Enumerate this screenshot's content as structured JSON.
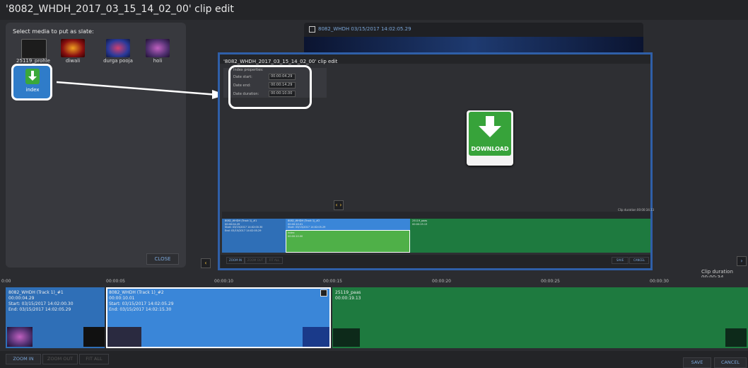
{
  "window": {
    "title": "'8082_WHDH_2017_03_15_14_02_00' clip edit"
  },
  "media_panel": {
    "label": "Select media to put as slate:",
    "items": [
      {
        "label": "25119_prohle",
        "icon": "video-thumbnail-icon"
      },
      {
        "label": "diwali",
        "icon": "diwali-thumbnail-icon"
      },
      {
        "label": "durga pooja",
        "icon": "durga-pooja-thumbnail-icon"
      },
      {
        "label": "holi",
        "icon": "holi-thumbnail-icon"
      },
      {
        "label": "index",
        "icon": "download-icon"
      }
    ],
    "close_label": "CLOSE"
  },
  "preview": {
    "title": "8082_WHDH  03/15/2017 14:02:05.29"
  },
  "nested": {
    "title": "'8082_WHDH_2017_03_15_14_02_00' clip edit",
    "props_heading": "Index properties:",
    "date_start_label": "Date start:",
    "date_start": "00:00:04.29",
    "date_end_label": "Date end:",
    "date_end": "00:00:14.29",
    "duration_label": "Date duration:",
    "duration": "00:00:10.00",
    "download_text": "DOWNLOAD",
    "clip_duration": "Clip duration 00:00:34.13",
    "clip1": {
      "line1": "8082_WHDH (Track 1)_#1",
      "line2": "00:00:04.29",
      "line3": "Start: 03/15/2017 14:02:00.30",
      "line4": "End: 03/15/2017 14:02:05.29"
    },
    "clip2": {
      "line1": "8082_WHDH (Track 1)_#2",
      "line2": "00:00:10.01",
      "line3": "Start: 03/15/2017 14:02:05.29",
      "line4": "End: 03/15/2017 14:02:15.30"
    },
    "clip2b": {
      "line1": "index",
      "line2": "00:00:10.00"
    },
    "clip3": {
      "line1": "25119_paas",
      "line2": "00:00:19.13"
    },
    "zoom_in": "ZOOM IN",
    "zoom_out": "ZOOM OUT",
    "fit_all": "FIT ALL",
    "save": "SAVE",
    "cancel": "CANCEL"
  },
  "timeline": {
    "ticks": [
      "0:00",
      "00:00:05",
      "00:00:10",
      "00:00:15",
      "00:00:20",
      "00:00:25",
      "00:00:30"
    ],
    "clip_duration": "Clip duration 00:00:34.",
    "clips": [
      {
        "line1": "8082_WHDH (Track 1)_#1",
        "line2": "00:00:04.29",
        "line3": "Start: 03/15/2017 14:02:00.30",
        "line4": "End: 03/15/2017 14:02:05.29"
      },
      {
        "line1": "8082_WHDH (Track 1)_#2",
        "line2": "00:00:10.01",
        "line3": "Start: 03/15/2017 14:02:05.29",
        "line4": "End: 03/15/2017 14:02:15.30"
      },
      {
        "line1": "25119_paas",
        "line2": "00:00:19.13"
      }
    ]
  },
  "bottom": {
    "zoom_in": "ZOOM IN",
    "zoom_out": "ZOOM OUT",
    "fit_all": "FIT ALL",
    "save": "SAVE",
    "cancel": "CANCEL"
  },
  "colors": {
    "accent": "#2f7cc9",
    "green": "#37a33a",
    "track_green": "#1e7a3f"
  }
}
